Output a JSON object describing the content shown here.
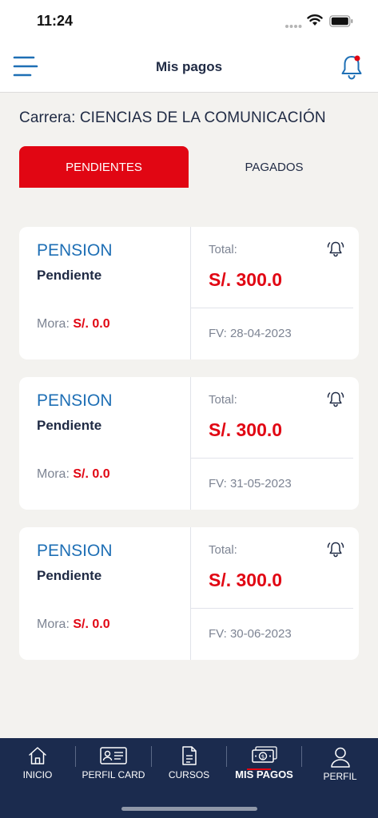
{
  "status_bar": {
    "time": "11:24"
  },
  "header": {
    "title": "Mis pagos"
  },
  "career": {
    "text": "Carrera: CIENCIAS DE LA COMUNICACIÓN"
  },
  "tabs": [
    {
      "label": "PENDIENTES",
      "active": true
    },
    {
      "label": "PAGADOS",
      "active": false
    }
  ],
  "payments": [
    {
      "concept": "PENSION",
      "state": "Pendiente",
      "mora_label": "Mora:",
      "mora_value": "S/. 0.0",
      "total_label": "Total:",
      "total_value": "S/. 300.0",
      "due_date": "FV: 28-04-2023"
    },
    {
      "concept": "PENSION",
      "state": "Pendiente",
      "mora_label": "Mora:",
      "mora_value": "S/. 0.0",
      "total_label": "Total:",
      "total_value": "S/. 300.0",
      "due_date": "FV: 31-05-2023"
    },
    {
      "concept": "PENSION",
      "state": "Pendiente",
      "mora_label": "Mora:",
      "mora_value": "S/. 0.0",
      "total_label": "Total:",
      "total_value": "S/. 300.0",
      "due_date": "FV: 30-06-2023"
    }
  ],
  "bottom_nav": {
    "items": [
      {
        "label": "INICIO",
        "icon": "home-icon"
      },
      {
        "label": "PERFIL CARD",
        "icon": "id-card-icon"
      },
      {
        "label": "CURSOS",
        "icon": "document-icon"
      },
      {
        "label": "MIS PAGOS",
        "icon": "money-icon",
        "active": true
      },
      {
        "label": "PERFIL",
        "icon": "user-icon"
      }
    ]
  },
  "colors": {
    "accent_red": "#e10613",
    "nav_bg": "#1b2b4e",
    "link_blue": "#1e6fb5",
    "page_bg": "#f3f2ef"
  }
}
